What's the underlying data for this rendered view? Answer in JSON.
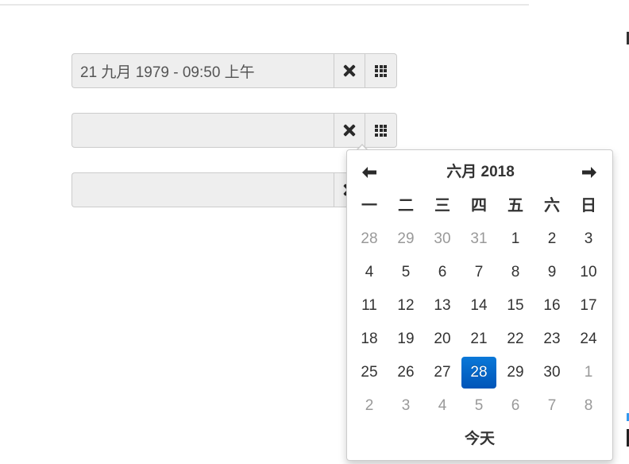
{
  "inputs": [
    {
      "value": "21 九月 1979 - 09:50 上午",
      "placeholder": ""
    },
    {
      "value": "",
      "placeholder": ""
    },
    {
      "value": "",
      "placeholder": ""
    }
  ],
  "picker": {
    "prev_label": "🡐",
    "next_label": "🡒",
    "title": "六月 2018",
    "weekdays": [
      "一",
      "二",
      "三",
      "四",
      "五",
      "六",
      "日"
    ],
    "days": [
      {
        "label": "28",
        "state": "muted"
      },
      {
        "label": "29",
        "state": "muted"
      },
      {
        "label": "30",
        "state": "muted"
      },
      {
        "label": "31",
        "state": "muted"
      },
      {
        "label": "1",
        "state": "normal"
      },
      {
        "label": "2",
        "state": "normal"
      },
      {
        "label": "3",
        "state": "normal"
      },
      {
        "label": "4",
        "state": "normal"
      },
      {
        "label": "5",
        "state": "normal"
      },
      {
        "label": "6",
        "state": "normal"
      },
      {
        "label": "7",
        "state": "normal"
      },
      {
        "label": "8",
        "state": "normal"
      },
      {
        "label": "9",
        "state": "normal"
      },
      {
        "label": "10",
        "state": "normal"
      },
      {
        "label": "11",
        "state": "normal"
      },
      {
        "label": "12",
        "state": "normal"
      },
      {
        "label": "13",
        "state": "normal"
      },
      {
        "label": "14",
        "state": "normal"
      },
      {
        "label": "15",
        "state": "normal"
      },
      {
        "label": "16",
        "state": "normal"
      },
      {
        "label": "17",
        "state": "normal"
      },
      {
        "label": "18",
        "state": "normal"
      },
      {
        "label": "19",
        "state": "normal"
      },
      {
        "label": "20",
        "state": "normal"
      },
      {
        "label": "21",
        "state": "normal"
      },
      {
        "label": "22",
        "state": "normal"
      },
      {
        "label": "23",
        "state": "normal"
      },
      {
        "label": "24",
        "state": "normal"
      },
      {
        "label": "25",
        "state": "normal"
      },
      {
        "label": "26",
        "state": "normal"
      },
      {
        "label": "27",
        "state": "normal"
      },
      {
        "label": "28",
        "state": "active"
      },
      {
        "label": "29",
        "state": "normal"
      },
      {
        "label": "30",
        "state": "normal"
      },
      {
        "label": "1",
        "state": "muted"
      },
      {
        "label": "2",
        "state": "muted"
      },
      {
        "label": "3",
        "state": "muted"
      },
      {
        "label": "4",
        "state": "muted"
      },
      {
        "label": "5",
        "state": "muted"
      },
      {
        "label": "6",
        "state": "muted"
      },
      {
        "label": "7",
        "state": "muted"
      },
      {
        "label": "8",
        "state": "muted"
      }
    ],
    "today_label": "今天"
  },
  "colors": {
    "active_day": "#0068c9",
    "muted_day": "#999999",
    "input_background": "#eeeeee"
  },
  "icons": {
    "clear": "close-icon",
    "calendar": "calendar-grid-icon",
    "prev": "arrow-left-icon",
    "next": "arrow-right-icon"
  }
}
